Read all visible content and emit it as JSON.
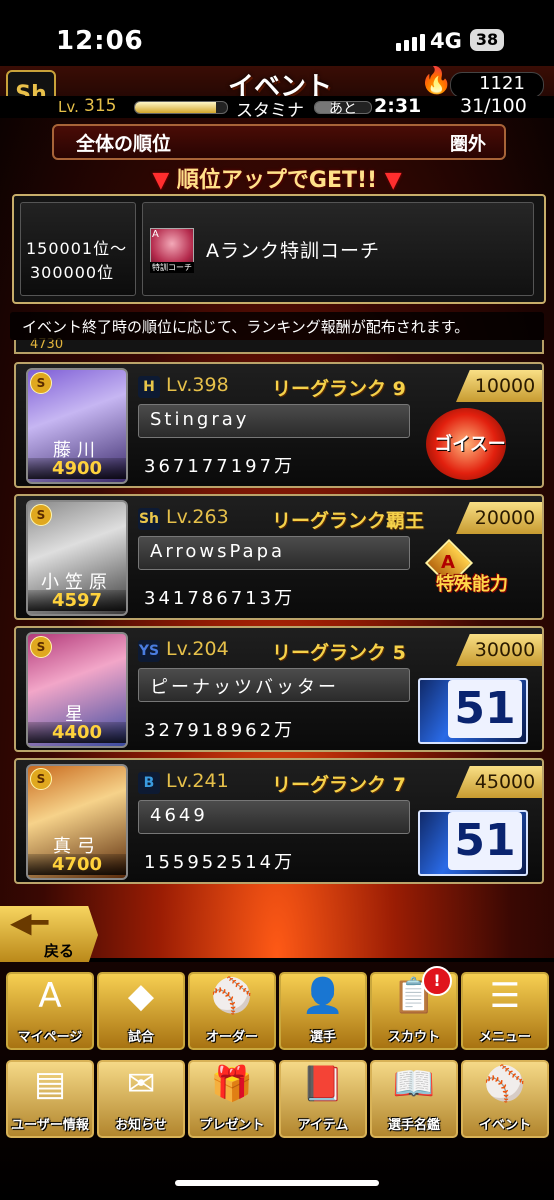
{
  "status": {
    "time": "12:06",
    "network": "4G",
    "battery": "38"
  },
  "header": {
    "logo": "Sh",
    "title": "イベント",
    "coins": "1121",
    "lv_label": "Lv.",
    "level": "315",
    "xp_fraction": 0.88,
    "stamina_label": "スタミナ",
    "stamina_fraction": 0.31,
    "remaining_label": "あと",
    "timer": "2:31",
    "stamina_count": "31/100"
  },
  "ranking": {
    "label": "全体の順位",
    "value": "圏外"
  },
  "banner": "順位アップでGET!!",
  "reward": {
    "range_line1": "150001位～",
    "range_line2": "300000位",
    "icon_grade": "A",
    "icon_label": "特訓コーチ",
    "name": "Aランク特訓コーチ"
  },
  "notice": "イベント終了時の順位に応じて、ランキング報酬が配布されます。",
  "partial_row_number": "4730",
  "players": [
    {
      "card_name": "藤川",
      "card_power": "4900",
      "card_tier": "S",
      "team": "H",
      "team_color": "#e8c54a",
      "lv": "Lv.398",
      "league": "リーグランク 9",
      "points": "10000",
      "user": "Stingray",
      "score": "367177197万",
      "prize": "ゴイスー",
      "prize_icon": "goisu-badge-icon"
    },
    {
      "card_name": "小笠原",
      "card_power": "4597",
      "card_tier": "S",
      "team": "Sh",
      "team_color": "#e8c54a",
      "lv": "Lv.263",
      "league": "リーグランク覇王",
      "points": "20000",
      "user": "ArrowsPapa",
      "score": "341786713万",
      "prize": "特殊能力",
      "prize_icon": "special-ability-icon"
    },
    {
      "card_name": "星",
      "card_power": "4400",
      "card_tier": "S",
      "team": "YS",
      "team_color": "#4a7de0",
      "lv": "Lv.204",
      "league": "リーグランク 5",
      "points": "30000",
      "user": "ピーナッツバッター",
      "score": "327918962万",
      "prize": "51",
      "prize_icon": "number-51-card-icon"
    },
    {
      "card_name": "真弓",
      "card_power": "4700",
      "card_tier": "S",
      "team": "B",
      "team_color": "#3a9be0",
      "lv": "Lv.241",
      "league": "リーグランク 7",
      "points": "45000",
      "user": "4649",
      "score": "155952514万",
      "prize": "51",
      "prize_icon": "number-51-card-icon"
    }
  ],
  "back_label": "戻る",
  "nav_row1": [
    {
      "label": "マイページ",
      "icon": "A"
    },
    {
      "label": "試合",
      "icon": "◆"
    },
    {
      "label": "オーダー",
      "icon": "⚾"
    },
    {
      "label": "選手",
      "icon": "👤"
    },
    {
      "label": "スカウト",
      "icon": "📋"
    },
    {
      "label": "メニュー",
      "icon": "☰"
    }
  ],
  "nav_row2": [
    {
      "label": "ユーザー情報",
      "icon": "▤"
    },
    {
      "label": "お知らせ",
      "icon": "✉"
    },
    {
      "label": "プレゼント",
      "icon": "🎁"
    },
    {
      "label": "アイテム",
      "icon": "📕"
    },
    {
      "label": "選手名鑑",
      "icon": "📖"
    },
    {
      "label": "イベント",
      "icon": "⚾"
    }
  ],
  "scout_badge": "!"
}
